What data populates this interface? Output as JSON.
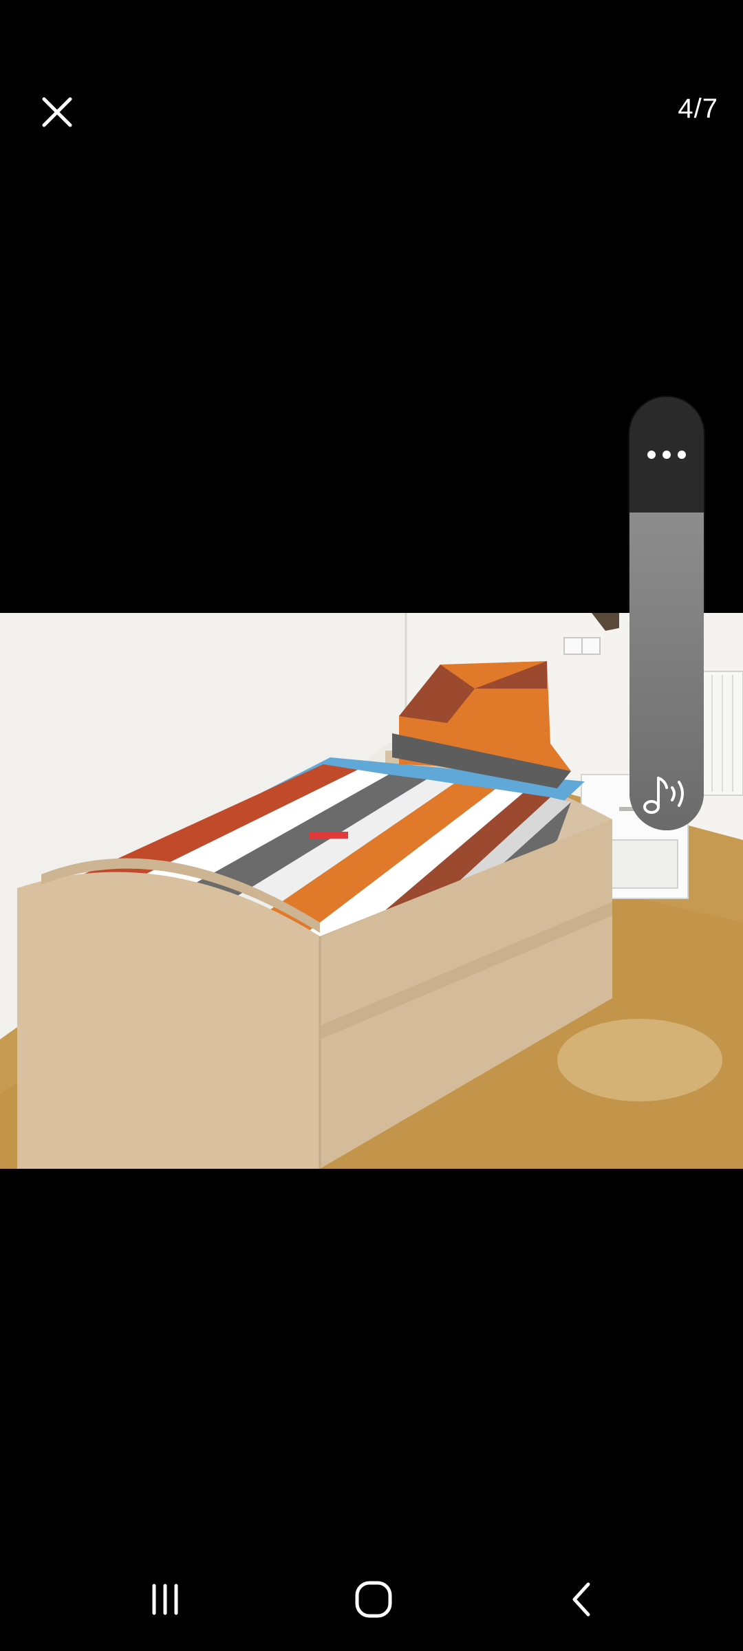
{
  "viewer": {
    "counter": "4/7",
    "close_icon": "close-icon"
  },
  "volume_panel": {
    "more_icon": "more-horizontal-icon",
    "media_icon": "music-note-volume-icon",
    "level": 0.85
  },
  "nav_bar": {
    "recents_icon": "recent-apps-icon",
    "home_icon": "home-icon",
    "back_icon": "back-icon"
  },
  "colors": {
    "background": "#000000",
    "panel": "#2a2a2a",
    "track": "#7a7a7a",
    "foreground": "#ffffff"
  }
}
